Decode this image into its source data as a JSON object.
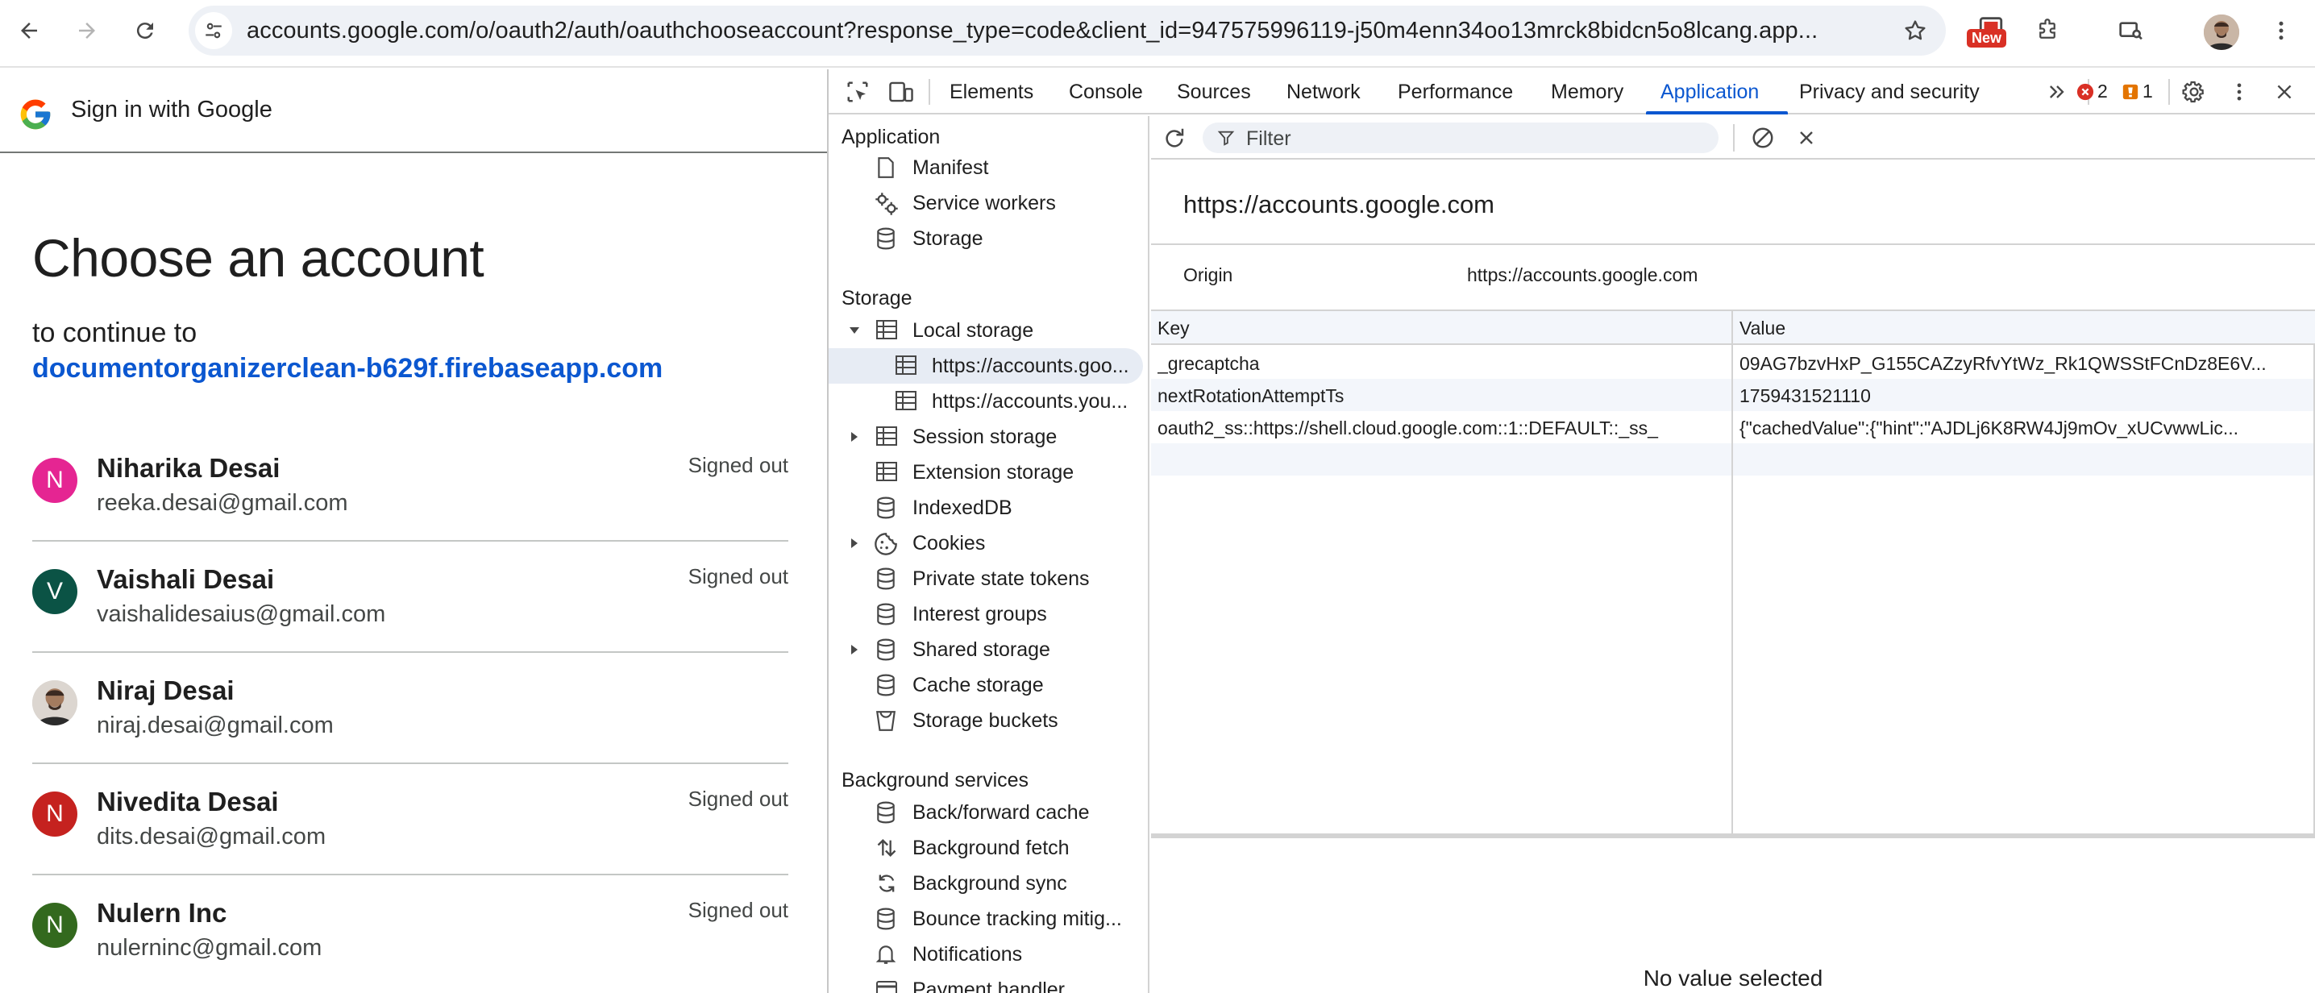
{
  "browser": {
    "url": "accounts.google.com/o/oauth2/auth/oauthchooseaccount?response_type=code&client_id=947575996119-j50m4enn34oo13mrck8bidcn5o8lcang.app...",
    "new_badge": "New"
  },
  "signin": {
    "header_title": "Sign in with Google",
    "title": "Choose an account",
    "continue_text": "to continue to",
    "continue_app": "documentorganizerclean-b629f.firebaseapp.com",
    "accounts": [
      {
        "initial": "N",
        "name": "Niharika Desai",
        "email": "reeka.desai@gmail.com",
        "status": "Signed out",
        "color": "#e52592"
      },
      {
        "initial": "V",
        "name": "Vaishali Desai",
        "email": "vaishalidesaius@gmail.com",
        "status": "Signed out",
        "color": "#0b5345"
      },
      {
        "initial": "",
        "name": "Niraj Desai",
        "email": "niraj.desai@gmail.com",
        "status": "",
        "color": "#8a6a55"
      },
      {
        "initial": "N",
        "name": "Nivedita Desai",
        "email": "dits.desai@gmail.com",
        "status": "Signed out",
        "color": "#c5221f"
      },
      {
        "initial": "N",
        "name": "Nulern Inc",
        "email": "nulerninc@gmail.com",
        "status": "Signed out",
        "color": "#33691e"
      }
    ]
  },
  "devtools": {
    "tabs": [
      "Elements",
      "Console",
      "Sources",
      "Network",
      "Performance",
      "Memory",
      "Application",
      "Privacy and security"
    ],
    "active_tab": "Application",
    "error_count": "2",
    "warning_count": "1",
    "sidebar": {
      "application_header": "Application",
      "application_items": [
        "Manifest",
        "Service workers",
        "Storage"
      ],
      "storage_header": "Storage",
      "storage_items": [
        "Local storage",
        "https://accounts.goo...",
        "https://accounts.you...",
        "Session storage",
        "Extension storage",
        "IndexedDB",
        "Cookies",
        "Private state tokens",
        "Interest groups",
        "Shared storage",
        "Cache storage",
        "Storage buckets"
      ],
      "background_header": "Background services",
      "background_items": [
        "Back/forward cache",
        "Background fetch",
        "Background sync",
        "Bounce tracking mitig...",
        "Notifications",
        "Payment handler"
      ]
    },
    "filter_placeholder": "Filter",
    "origin_title": "https://accounts.google.com",
    "origin_label": "Origin",
    "origin_value": "https://accounts.google.com",
    "table": {
      "headers": [
        "Key",
        "Value"
      ],
      "rows": [
        {
          "key": "_grecaptcha",
          "value": "09AG7bzvHxP_G155CAZzyRfvYtWz_Rk1QWSStFCnDz8E6V..."
        },
        {
          "key": "nextRotationAttemptTs",
          "value": "1759431521110"
        },
        {
          "key": "oauth2_ss::https://shell.cloud.google.com::1::DEFAULT::_ss_",
          "value": "{\"cachedValue\":{\"hint\":\"AJDLj6K8RW4Jj9mOv_xUCvwwLic..."
        }
      ]
    },
    "no_value": "No value selected"
  }
}
